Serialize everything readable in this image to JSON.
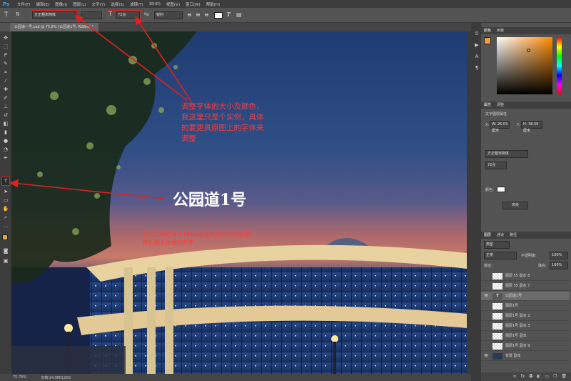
{
  "menubar": {
    "logo": "Ps",
    "items": [
      "文件(F)",
      "编辑(E)",
      "图像(I)",
      "图层(L)",
      "文字(Y)",
      "选择(S)",
      "滤镜(T)",
      "3D(D)",
      "视图(V)",
      "窗口(W)",
      "帮助(H)"
    ]
  },
  "options": {
    "font_family": "方正粗宋简体",
    "font_size": "72点",
    "antialias": "锐利"
  },
  "document": {
    "tab_title": "公园道一号.psd @ 75.8% (公园道1号, RGB/8) *"
  },
  "canvas": {
    "headline": "公园道1号",
    "annotation1": "调整字体的大小及颜色，\n我这里只是个实例，具体\n的要更具原图上的字体来\n调整",
    "annotation2": "左边工具栏有个T的标志或者直接按快捷键T\n然后输入你要打的字"
  },
  "status": {
    "zoom": "75.79%",
    "doc": "文档:14.9M/125G"
  },
  "panels": {
    "color_tabs": [
      "颜色",
      "色板"
    ],
    "props_tabs": [
      "属性",
      "调整"
    ],
    "props_title": "文字图层属性",
    "w_label": "W: 26.03 厘米",
    "h_label": "H: 38.59 厘米",
    "x_label": "X:",
    "y_label": "Y:",
    "font": "方正粗宋简体",
    "size": "72点",
    "color_label": "颜色:",
    "advanced": "高级",
    "layer_tabs": [
      "图层",
      "通道",
      "路径"
    ],
    "kind": "类型",
    "blend": "正常",
    "opacity_label": "不透明度:",
    "opacity": "100%",
    "lock_label": "锁定:",
    "fill_label": "填充:",
    "fill": "100%"
  },
  "layers": [
    {
      "name": "图层 55 副本 8",
      "type": "image"
    },
    {
      "name": "图层 55 副本 7",
      "type": "image"
    },
    {
      "name": "公园道1号",
      "type": "text"
    },
    {
      "name": "图层1号",
      "type": "image"
    },
    {
      "name": "图层1号 副本 2",
      "type": "image"
    },
    {
      "name": "图层1号 副本 3",
      "type": "image"
    },
    {
      "name": "图层1号 副本",
      "type": "image"
    },
    {
      "name": "图层1号 副本 9",
      "type": "image"
    },
    {
      "name": "背景 副本",
      "type": "image"
    }
  ],
  "colors": {
    "accent_red": "#e02020",
    "annotation_text": "#ff3030",
    "ui_dark": "#3c3c3c",
    "ui_mid": "#535353"
  }
}
